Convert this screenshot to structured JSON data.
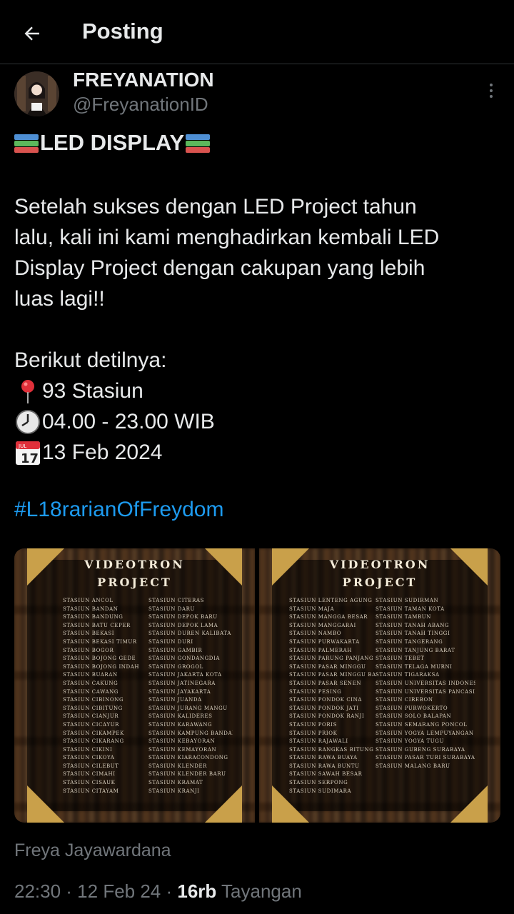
{
  "header": {
    "title": "Posting",
    "back_icon": "arrow-left-icon"
  },
  "author": {
    "name": "FREYANATION",
    "handle": "@FreyanationID"
  },
  "post": {
    "headline": "LED DISPLAY",
    "paragraph_lines": [
      "Setelah sukses dengan LED Project tahun",
      "lalu, kali ini kami menghadirkan kembali LED",
      "Display Project dengan cakupan yang lebih",
      "luas lagi!!"
    ],
    "intro": "Berikut detilnya:",
    "stations": "93 Stasiun",
    "hours": "04.00 - 23.00 WIB",
    "date": "13 Feb 2024",
    "calendar_month": "JUL",
    "calendar_day": "17",
    "hashtag": "#L18rarianOfFreydom"
  },
  "media": {
    "left": {
      "title_line1": "VIDEOTRON",
      "title_line2": "PROJECT",
      "col1": [
        "Stasiun Ancol",
        "Stasiun Bandan",
        "Stasiun Bandung",
        "Stasiun Batu Ceper",
        "Stasiun Bekasi",
        "Stasiun Bekasi Timur",
        "Stasiun Bogor",
        "Stasiun Bojong Gede",
        "Stasiun Bojong Indah",
        "Stasiun Buaran",
        "Stasiun Cakung",
        "Stasiun Cawang",
        "Stasiun Cibinong",
        "Stasiun Cibitung",
        "Stasiun Cianjur",
        "Stasiun Cicayur",
        "Stasiun Cikampek",
        "Stasiun Cikarang",
        "Stasiun Cikini",
        "Stasiun Cikoya",
        "Stasiun Cilebut",
        "Stasiun Cimahi",
        "Stasiun Cisauk",
        "Stasiun Citayam"
      ],
      "col2": [
        "Stasiun Citeras",
        "Stasiun Daru",
        "Stasiun Depok Baru",
        "Stasiun Depok Lama",
        "Stasiun Duren Kalibata",
        "Stasiun Duri",
        "Stasiun Gambir",
        "Stasiun Gondangdia",
        "Stasiun Grogol",
        "Stasiun Jakarta Kota",
        "Stasiun Jatinegara",
        "Stasiun Jayakarta",
        "Stasiun Juanda",
        "Stasiun Jurang Mangu",
        "Stasiun Kalideres",
        "Stasiun Karawang",
        "Stasiun Kampung Bandan",
        "Stasiun Kebayoran",
        "Stasiun Kemayoran",
        "Stasiun Kiaracondong",
        "Stasiun Klender",
        "Stasiun Klender Baru",
        "Stasiun Kramat",
        "Stasiun Kranji"
      ]
    },
    "right": {
      "title_line1": "VIDEOTRON",
      "title_line2": "PROJECT",
      "col1": [
        "Stasiun Lenteng Agung",
        "Stasiun Maja",
        "Stasiun Mangga Besar",
        "Stasiun Manggarai",
        "Stasiun Nambo",
        "Stasiun Purwakarta",
        "Stasiun Palmerah",
        "Stasiun Parung Panjang",
        "Stasiun Pasar Minggu",
        "Stasiun Pasar Minggu Baru",
        "Stasiun Pasar Senen",
        "Stasiun Pesing",
        "Stasiun Pondok Cina",
        "Stasiun Pondok Jati",
        "Stasiun Pondok Ranji",
        "Stasiun Poris",
        "Stasiun Priok",
        "Stasiun Rajawali",
        "Stasiun Rangkas Bitung",
        "Stasiun Rawa Buaya",
        "Stasiun Rawa Buntu",
        "Stasiun Sawah Besar",
        "Stasiun Serpong",
        "Stasiun Sudimara"
      ],
      "col2": [
        "Stasiun Sudirman",
        "Stasiun Taman Kota",
        "Stasiun Tambun",
        "Stasiun Tanah Abang",
        "Stasiun Tanah Tinggi",
        "Stasiun Tangerang",
        "Stasiun Tanjung Barat",
        "Stasiun Tebet",
        "Stasiun Telaga Murni",
        "Stasiun Tigaraksa",
        "Stasiun Universitas Indonesia",
        "Stasiun Universitas Pancasila",
        "Stasiun Cirebon",
        "Stasiun Purwokerto",
        "Stasiun Solo Balapan",
        "Stasiun Semarang Poncol",
        "Stasiun Yogya Lempuyangan",
        "Stasiun Yogya Tugu",
        "Stasiun Gubeng Surabaya",
        "Stasiun Pasar Turi Surabaya",
        "Stasiun Malang Baru"
      ]
    }
  },
  "quote_author": "Freya Jayawardana",
  "meta": {
    "time": "22:30 · 12 Feb 24 · ",
    "views": "16rb",
    "views_label": " Tayangan"
  },
  "colors": {
    "background": "#000000",
    "text": "#e7e9ea",
    "muted": "#71767b",
    "link": "#1d9bf0",
    "gold": "#c9a04a"
  }
}
